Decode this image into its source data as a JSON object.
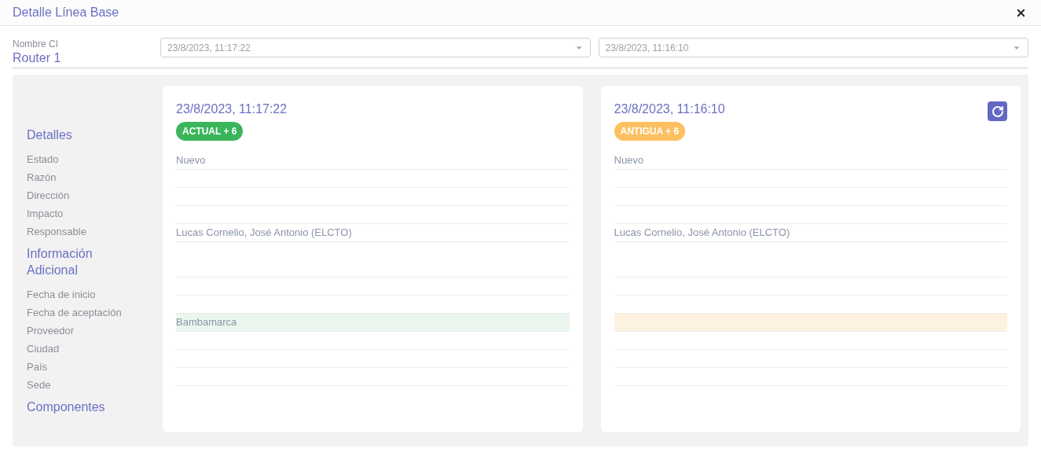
{
  "window": {
    "title": "Detalle Línea Base"
  },
  "ci": {
    "label": "Nombre CI",
    "value": "Router 1"
  },
  "selects": [
    {
      "value": "23/8/2023, 11:17:22"
    },
    {
      "value": "23/8/2023, 11:16:10"
    }
  ],
  "sections": [
    {
      "title": "Detalles",
      "fields": [
        "Estado",
        "Razón",
        "Dirección",
        "Impacto",
        "Responsable"
      ]
    },
    {
      "title": "Información Adicional",
      "fields": [
        "Fecha de inicio",
        "Fecha de aceptación",
        "Proveedor",
        "Ciudad",
        "País",
        "Sede"
      ]
    },
    {
      "title": "Componentes"
    }
  ],
  "versions": [
    {
      "kind": "current",
      "date": "23/8/2023, 11:17:22",
      "badge": "ACTUAL + 6",
      "restore": false,
      "values": [
        {
          "text": "Nuevo",
          "changed": false
        },
        {
          "changed": false
        },
        {
          "changed": false
        },
        {
          "changed": false
        },
        {
          "text": "Lucas Cornelio, José Antonio (ELCTO)",
          "changed": false
        },
        {
          "changed": false
        },
        {
          "changed": false
        },
        {
          "text": "Bambamarca",
          "changed": true
        },
        {
          "changed": false
        },
        {
          "changed": false
        },
        {
          "changed": false
        }
      ]
    },
    {
      "kind": "old",
      "date": "23/8/2023, 11:16:10",
      "badge": "ANTIGUA + 6",
      "restore": true,
      "values": [
        {
          "text": "Nuevo",
          "changed": false
        },
        {
          "changed": false
        },
        {
          "changed": false
        },
        {
          "changed": false
        },
        {
          "text": "Lucas Cornelio, José Antonio (ELCTO)",
          "changed": false
        },
        {
          "changed": false
        },
        {
          "changed": false
        },
        {
          "changed": true
        },
        {
          "changed": false
        },
        {
          "changed": false
        },
        {
          "changed": false
        }
      ]
    }
  ]
}
